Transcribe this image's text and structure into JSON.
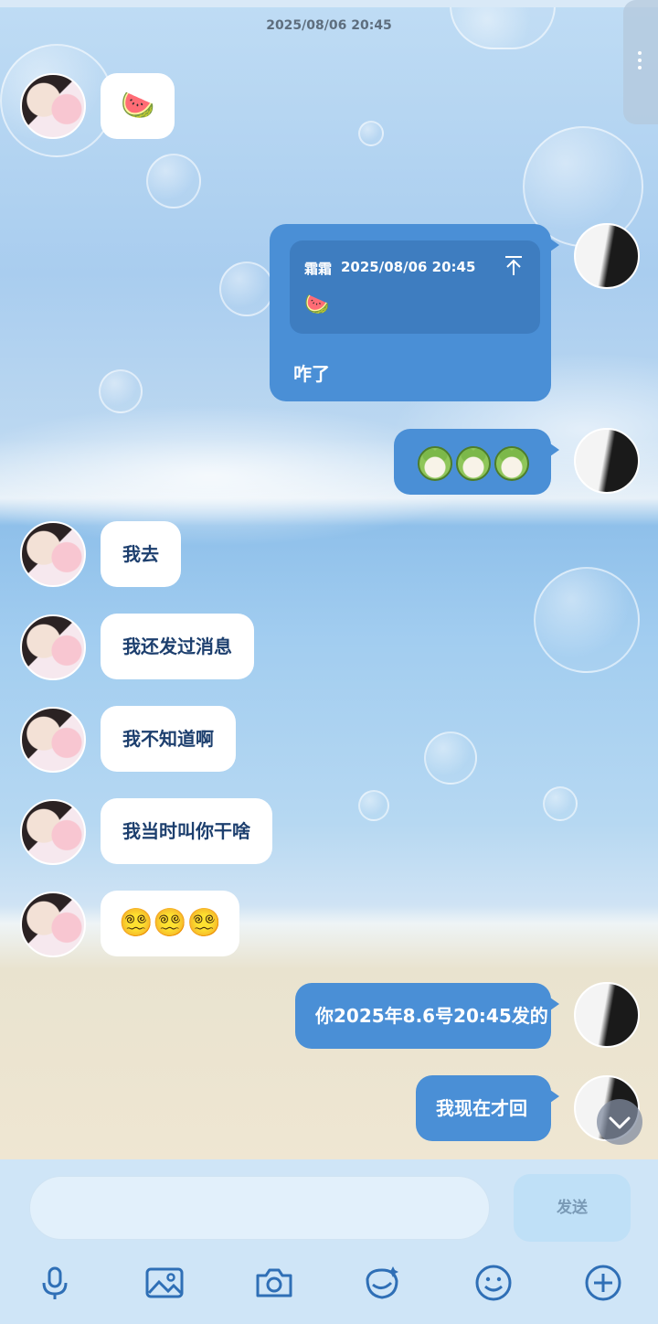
{
  "header": {
    "timestamp": "2025/08/06  20:45"
  },
  "messages": {
    "m1": {
      "emoji": "🍉"
    },
    "quote": {
      "sender": "霜霜",
      "time": "2025/08/06  20:45",
      "quoted_emoji": "🍉",
      "reply": "咋了"
    },
    "m3": {
      "stickers": [
        "frog-sticker",
        "frog-sticker",
        "frog-sticker"
      ]
    },
    "m4": {
      "text": "我去"
    },
    "m5": {
      "text": "我还发过消息"
    },
    "m6": {
      "text": "我不知道啊"
    },
    "m7": {
      "text": "我当时叫你干啥"
    },
    "m8": {
      "emoji": "😵‍💫😵‍💫😵‍💫"
    },
    "m9": {
      "text": "你2025年8.6号20:45发的"
    },
    "m10": {
      "text": "我现在才回"
    }
  },
  "composer": {
    "placeholder": "",
    "send_label": "发送"
  },
  "toolbar": {
    "icons": [
      "microphone-icon",
      "image-icon",
      "camera-icon",
      "sticker-icon",
      "emoji-icon",
      "plus-icon"
    ]
  },
  "colors": {
    "accent": "#4a8fd6",
    "bubble_left": "#ffffff",
    "text_dark": "#1d3f6e"
  }
}
